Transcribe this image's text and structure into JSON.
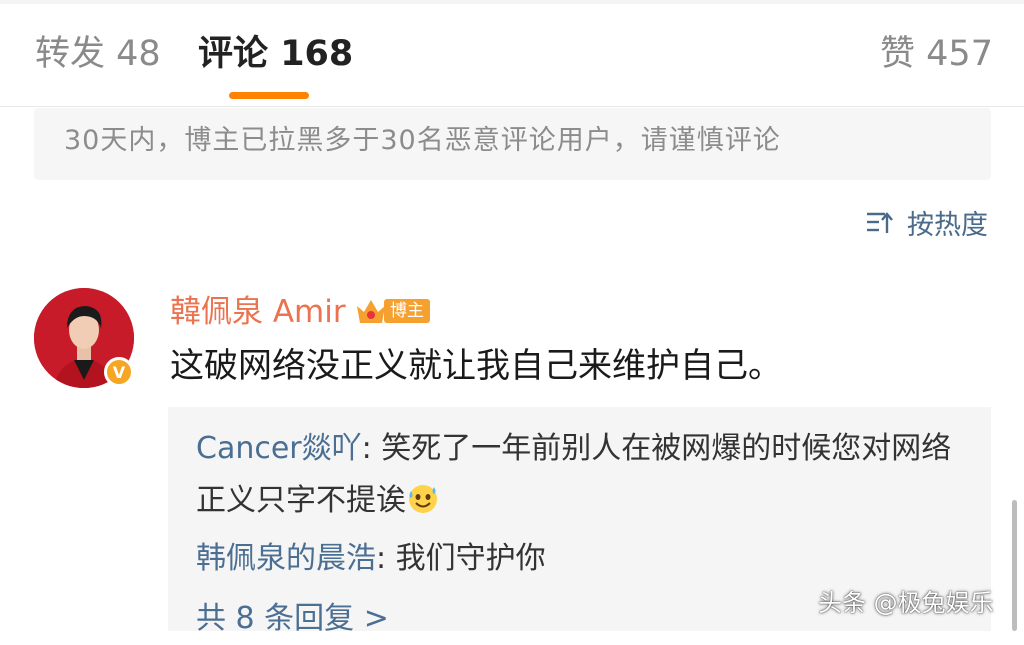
{
  "tabs": {
    "repost": {
      "label": "转发",
      "count": "48"
    },
    "comment": {
      "label": "评论",
      "count": "168"
    },
    "like": {
      "label": "赞",
      "count": "457"
    }
  },
  "notice": "30天内，博主已拉黑多于30名恶意评论用户，请谨慎评论",
  "sort": {
    "label": "按热度",
    "icon": "sort-icon"
  },
  "comment": {
    "username": "韓佩泉 Amir",
    "badge": "博主",
    "text": "这破网络没正义就让我自己来维护自己。",
    "verified_icon": "v-badge-icon"
  },
  "replies": [
    {
      "name": "Cancer燚吖",
      "text": "笑死了一年前别人在被网爆的时候您对网络正义只字不提诶",
      "emoji": "sweat-smile-emoji"
    },
    {
      "name": "韩佩泉的晨浩",
      "text": "我们守护你"
    }
  ],
  "more_replies": "共 8 条回复 >",
  "watermark": "头条 @极兔娱乐",
  "colors": {
    "accent": "#ff8200",
    "username": "#eb7350",
    "link": "#4b6e93",
    "badge": "#f6a02f"
  }
}
